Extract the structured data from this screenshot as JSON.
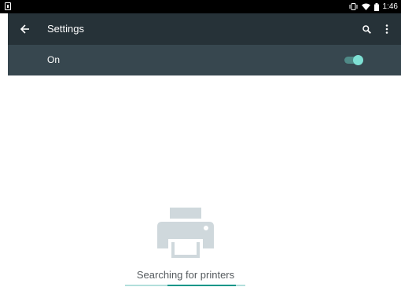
{
  "status_bar": {
    "time": "1:46",
    "icons": [
      "download-icon",
      "vibrate-icon",
      "wifi-icon",
      "battery-icon"
    ]
  },
  "toolbar": {
    "title": "Settings",
    "back_icon": "arrow-back-icon",
    "search_icon": "search-icon",
    "overflow_icon": "more-vert-icon",
    "bg_color": "#263238"
  },
  "switch_bar": {
    "label": "On",
    "checked": true,
    "bg_color": "#37474f",
    "accent_color": "#80cbc4"
  },
  "empty_state": {
    "icon": "printer-icon",
    "message": "Searching for printers",
    "progress_color": "#009688"
  }
}
